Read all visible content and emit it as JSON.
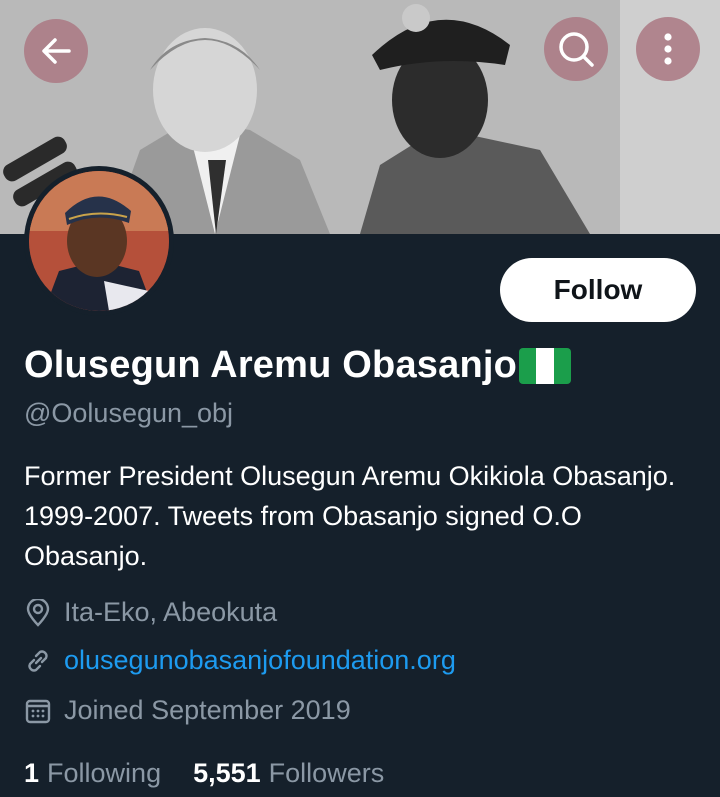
{
  "header": {
    "back_icon": "arrow-left-icon",
    "search_icon": "search-icon",
    "more_icon": "more-vertical-icon",
    "button_color": "#aa7882"
  },
  "profile": {
    "display_name": "Olusegun Aremu Obasanjo",
    "flag_icon": "nigeria-flag-icon",
    "handle": "@Oolusegun_obj",
    "follow_label": "Follow",
    "bio": "Former President Olusegun Aremu Okikiola Obasanjo. 1999-2007. Tweets from Obasanjo signed O.O Obasanjo.",
    "location": "Ita-Eko, Abeokuta",
    "website": "olusegunobasanjofoundation.org",
    "joined": "Joined September 2019",
    "following_count": "1",
    "following_label": "Following",
    "followers_count": "5,551",
    "followers_label": "Followers"
  },
  "colors": {
    "background": "#15202b",
    "secondary_text": "#8b98a5",
    "link": "#1d9bf0"
  }
}
